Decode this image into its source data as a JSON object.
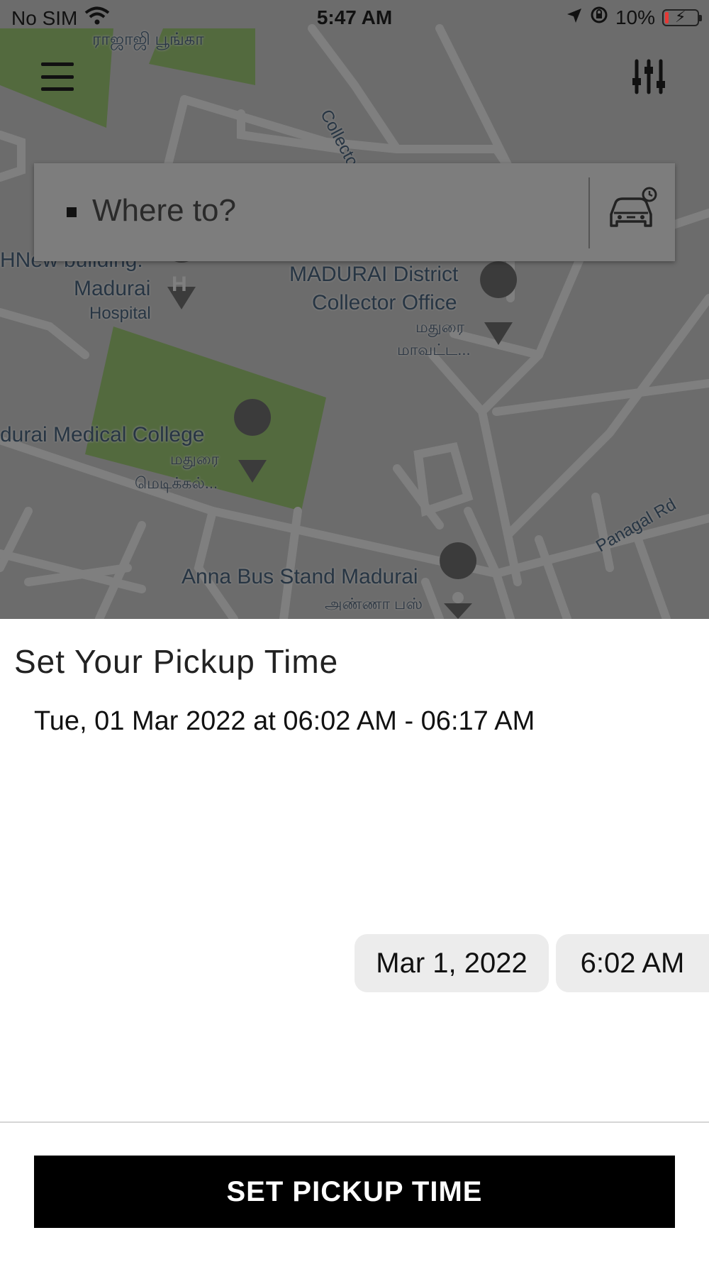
{
  "status_bar": {
    "carrier": "No SIM",
    "time": "5:47 AM",
    "battery": "10%"
  },
  "map": {
    "labels": {
      "tamil_park": "ராஜாஜி\nபூங்கா",
      "collector_road": "Collector O",
      "hospital_name": "HNew building:",
      "hospital_city": "Madurai",
      "hospital_sub": "Hospital",
      "collector_office_1": "MADURAI District",
      "collector_office_2": "Collector Office",
      "collector_office_tamil_1": "மதுரை",
      "collector_office_tamil_2": "மாவட்ட...",
      "medical_college": "durai Medical College",
      "medical_college_tamil_1": "மதுரை",
      "medical_college_tamil_2": "மெடிக்கல்...",
      "panagal_rd": "Panagal Rd",
      "bus_stand": "Anna Bus Stand Madurai",
      "bus_stand_tamil": "அண்ணா பஸ்"
    }
  },
  "search": {
    "placeholder": "Where to?"
  },
  "sheet": {
    "title": "Set Your Pickup Time",
    "range": "Tue, 01 Mar 2022 at 06:02 AM - 06:17 AM",
    "date_value": "Mar 1, 2022",
    "time_value": "6:02 AM",
    "cta_label": "SET PICKUP TIME"
  },
  "icons": {
    "menu": "hamburger-menu-icon",
    "filter": "sliders-icon",
    "scheduled_ride": "car-clock-icon",
    "wifi": "wifi-icon",
    "location": "location-arrow-icon",
    "rotation_lock": "rotation-lock-icon",
    "battery": "battery-charging-icon"
  },
  "colors": {
    "park_green": "#a6d47d",
    "cta_background": "#000000",
    "battery_low": "#e53935"
  }
}
